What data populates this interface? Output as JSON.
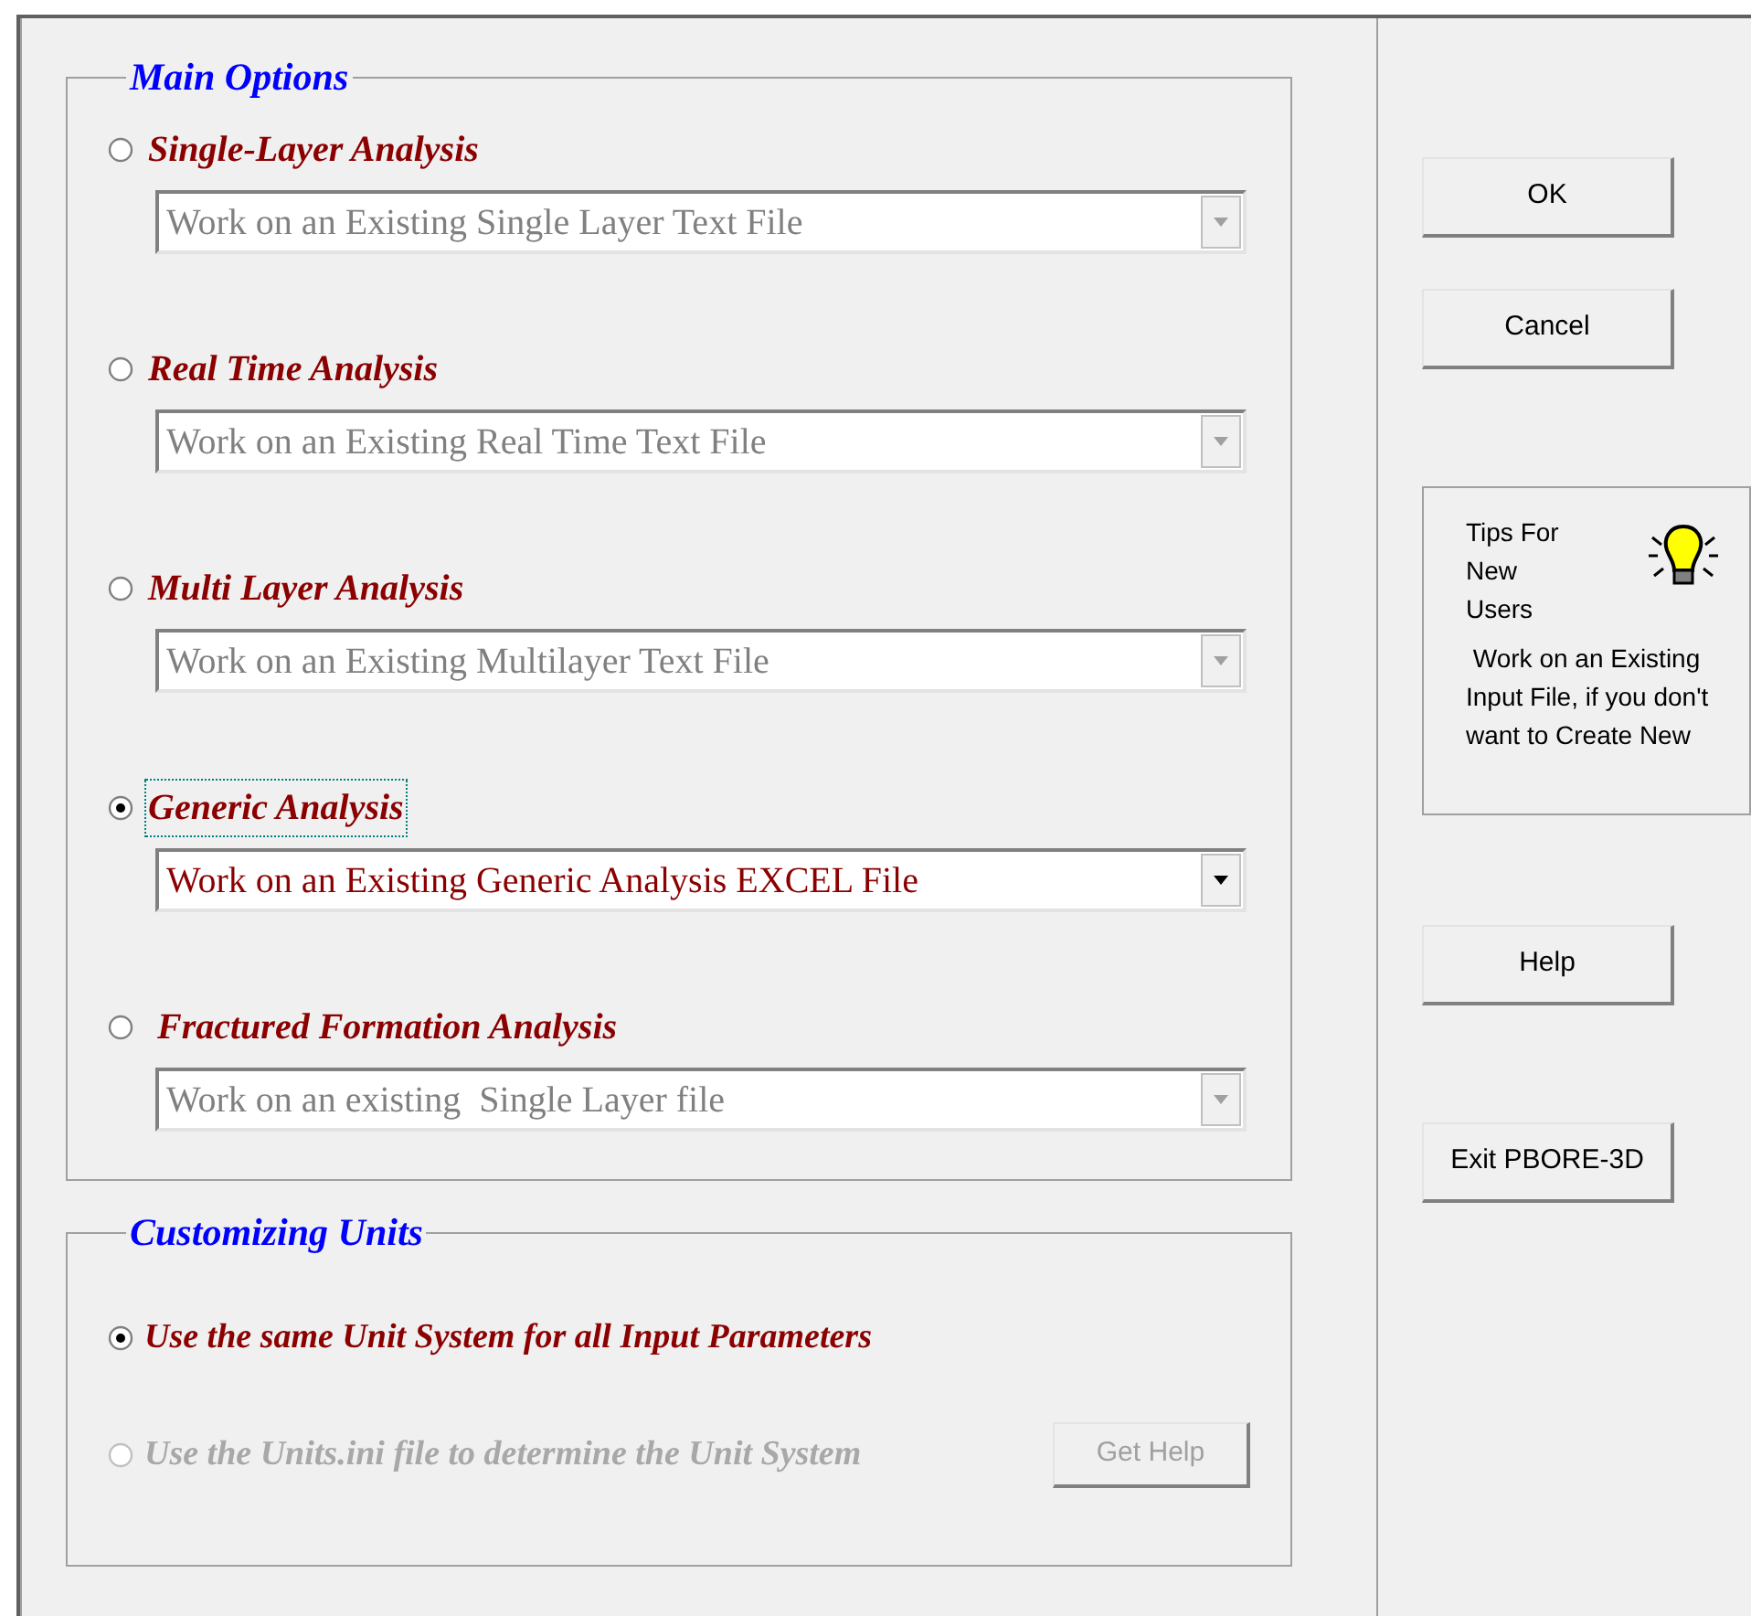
{
  "main_options": {
    "title": "Main Options",
    "options": [
      {
        "label": "Single-Layer Analysis",
        "selected": false,
        "focused": false,
        "dropdown": {
          "value": "Work on an Existing Single Layer Text File",
          "disabled": true
        }
      },
      {
        "label": "Real Time Analysis",
        "selected": false,
        "focused": false,
        "dropdown": {
          "value": "Work on an Existing Real Time Text File",
          "disabled": true
        }
      },
      {
        "label": "Multi Layer Analysis",
        "selected": false,
        "focused": false,
        "dropdown": {
          "value": "Work on an Existing Multilayer Text File",
          "disabled": true
        }
      },
      {
        "label": "Generic Analysis",
        "selected": true,
        "focused": true,
        "dropdown": {
          "value": "Work on an Existing Generic Analysis EXCEL File",
          "disabled": false
        }
      },
      {
        "label": " Fractured Formation Analysis",
        "selected": false,
        "focused": false,
        "dropdown": {
          "value": "Work on an existing  Single Layer file",
          "disabled": true
        }
      }
    ]
  },
  "customizing_units": {
    "title": "Customizing Units",
    "options": [
      {
        "label": "Use the same Unit System for all Input Parameters",
        "selected": true,
        "disabled": false
      },
      {
        "label": "Use the Units.ini file to determine the Unit System",
        "selected": false,
        "disabled": true,
        "button": {
          "label": "Get Help",
          "disabled": true
        }
      }
    ]
  },
  "buttons_top": [
    "OK",
    "Cancel"
  ],
  "tips": {
    "title": "Tips For New Users",
    "text": " Work on an Existing Input File, if you don't want to Create New"
  },
  "buttons_bottom": [
    "Help",
    "Exit PBORE-3D"
  ]
}
